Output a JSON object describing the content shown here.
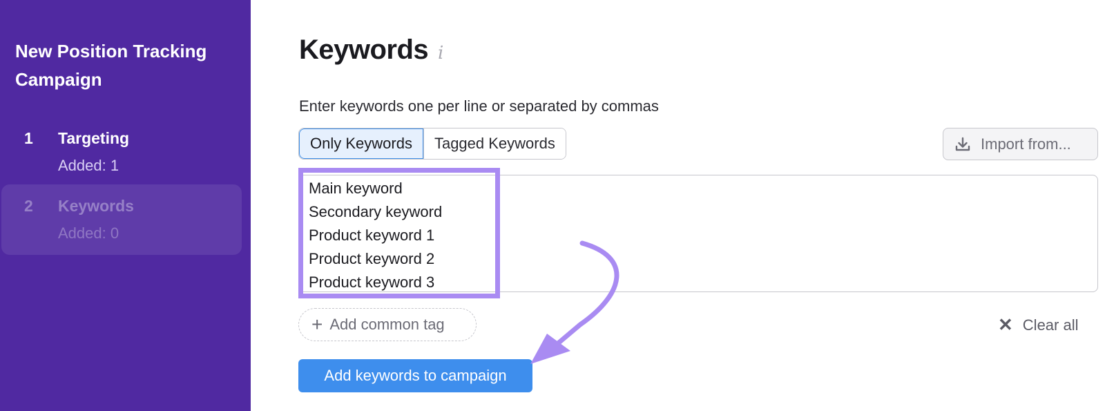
{
  "sidebar": {
    "title": "New Position Tracking Campaign",
    "steps": [
      {
        "number": "1",
        "name": "Targeting",
        "status": "Added: 1"
      },
      {
        "number": "2",
        "name": "Keywords",
        "status": "Added: 0"
      }
    ]
  },
  "main": {
    "title": "Keywords",
    "info_icon": "i",
    "instructions": "Enter keywords one per line or separated by commas",
    "tabs": [
      {
        "label": "Only Keywords",
        "selected": true
      },
      {
        "label": "Tagged Keywords",
        "selected": false
      }
    ],
    "import_label": "Import from...",
    "keywords": [
      "Main keyword",
      "Secondary keyword",
      "Product keyword 1",
      "Product keyword 2",
      "Product keyword 3"
    ],
    "add_tag_label": "Add common tag",
    "clear_all_label": "Clear all",
    "submit_label": "Add keywords to campaign"
  },
  "colors": {
    "sidebar_bg": "#5029a1",
    "highlight": "#a98bf2",
    "primary_button": "#3e8eed",
    "tab_selected_bg": "#e6f0fd"
  },
  "icons": {
    "import": "download-icon",
    "add_tag": "plus-icon",
    "clear": "close-icon",
    "annotation": "curved-arrow-icon"
  }
}
